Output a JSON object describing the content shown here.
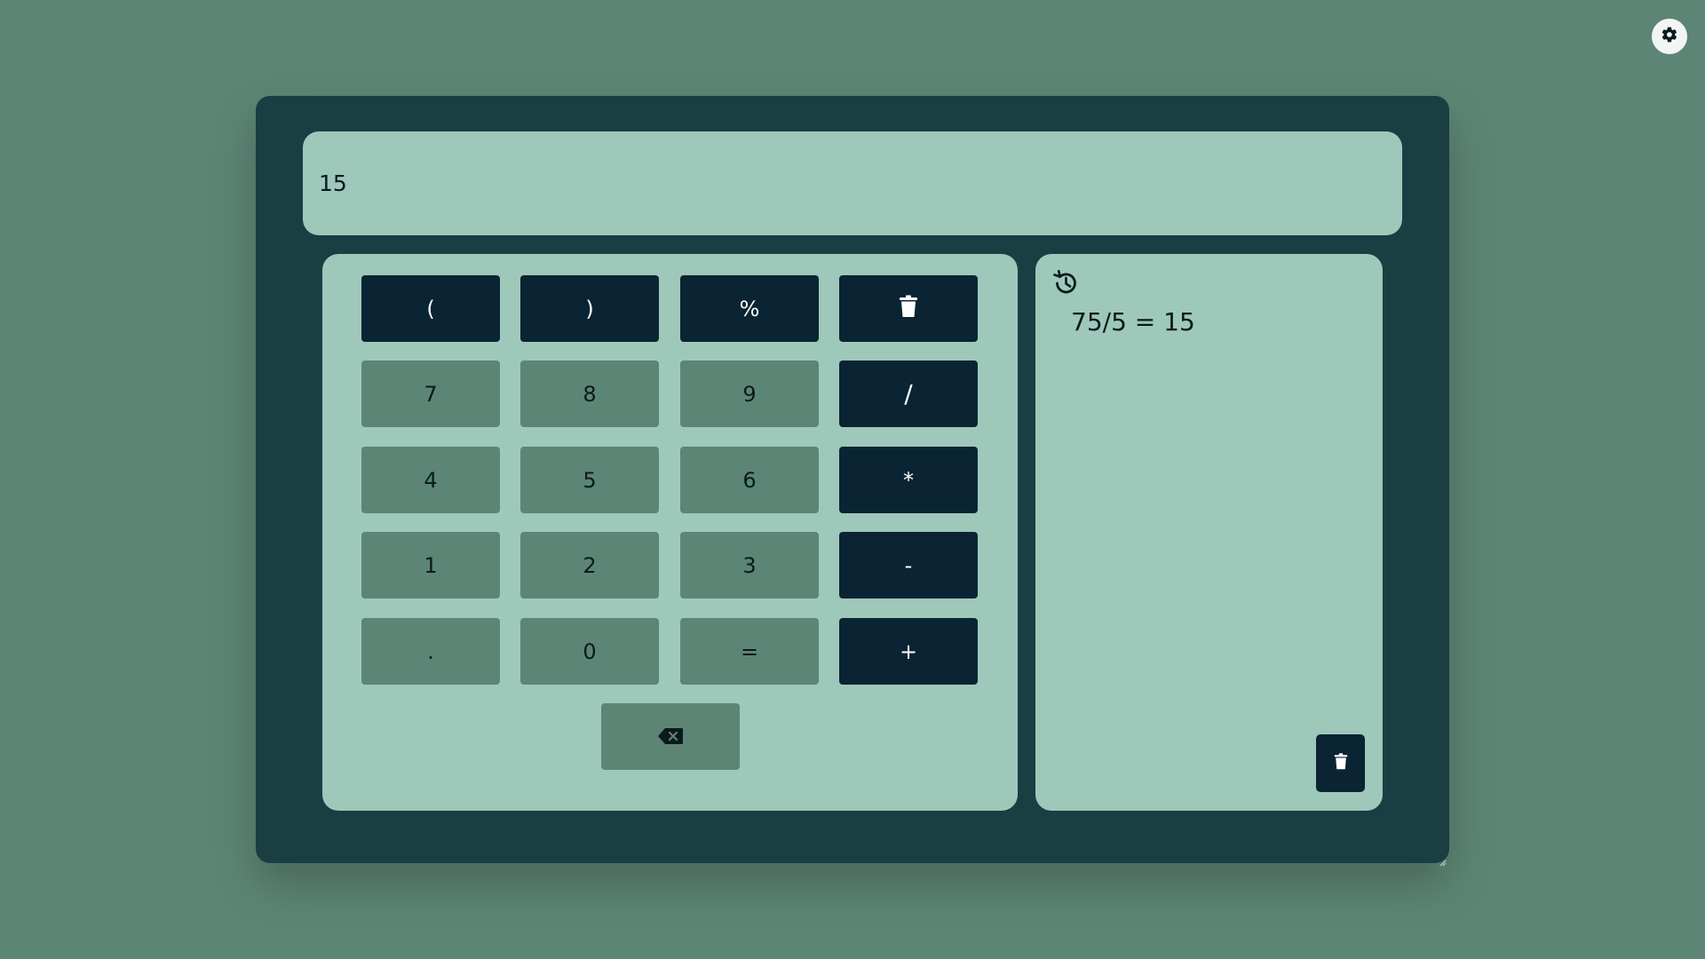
{
  "display": {
    "value": "15"
  },
  "keys": {
    "open_paren": "(",
    "close_paren": ")",
    "percent": "%",
    "seven": "7",
    "eight": "8",
    "nine": "9",
    "divide": "/",
    "four": "4",
    "five": "5",
    "six": "6",
    "multiply": "*",
    "one": "1",
    "two": "2",
    "three": "3",
    "minus": "-",
    "dot": ".",
    "zero": "0",
    "equals": "=",
    "plus": "+"
  },
  "history": {
    "entries": [
      "75/5 = 15"
    ]
  },
  "icons": {
    "theme_toggle": "gear-icon",
    "clear_all": "trash-icon",
    "backspace": "backspace-icon",
    "history": "history-icon",
    "clear_history": "trash-icon"
  },
  "colors": {
    "page_background": "#5d8575",
    "calculator_body": "#1a3e42",
    "panel": "#9ec8ba",
    "number_key": "#5d8575",
    "operator_key": "#0a2433"
  }
}
